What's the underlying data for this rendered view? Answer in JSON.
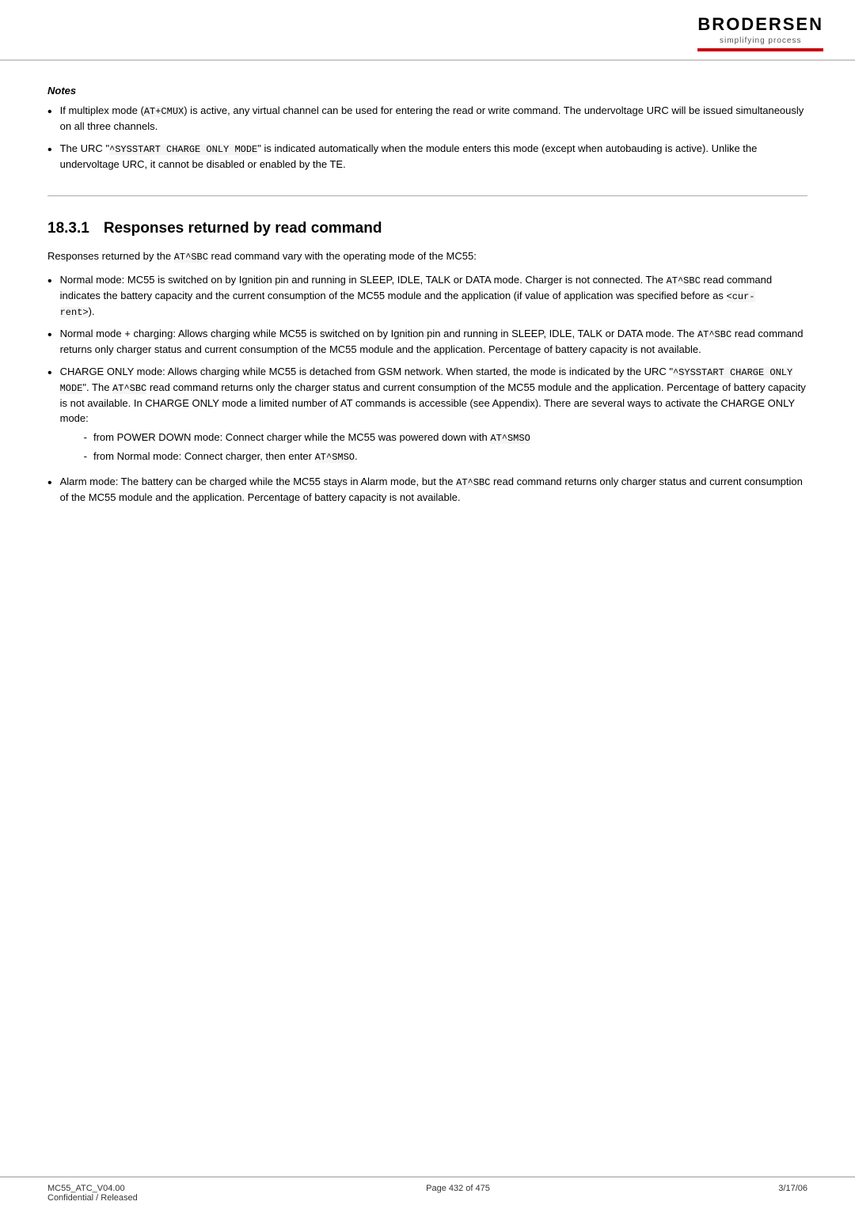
{
  "header": {
    "logo_text": "BRODERSEN",
    "logo_tagline": "simplifying process"
  },
  "notes": {
    "title": "Notes",
    "items": [
      {
        "text_before": "If multiplex mode (",
        "code1": "AT+CMUX",
        "text_after": ") is active, any virtual channel can be used for entering the read or write command. The undervoltage URC will be issued simultaneously on all three channels."
      },
      {
        "text_before": "The URC \"",
        "code1": "^SYSSTART CHARGE ONLY MODE",
        "text_after": "\" is indicated automatically when the module enters this mode (except when autobauding is active). Unlike the undervoltage URC, it cannot be disabled or enabled by the TE."
      }
    ]
  },
  "section": {
    "number": "18.3.1",
    "title": "Responses returned by read command",
    "intro_before": "Responses returned by the ",
    "intro_code": "AT^SBC",
    "intro_after": " read command vary with the operating mode of the MC55:",
    "bullets": [
      {
        "id": 0,
        "parts": [
          {
            "type": "text",
            "value": "Normal mode: MC55 is switched on by Ignition pin and running in SLEEP, IDLE, TALK or DATA mode. Charger is not connected. The "
          },
          {
            "type": "code",
            "value": "AT^SBC"
          },
          {
            "type": "text",
            "value": " read command indicates the battery capacity and the current consumption of the MC55 module and the application (if value of application was specified before as "
          },
          {
            "type": "code",
            "value": "<current>"
          },
          {
            "type": "text",
            "value": ")."
          }
        ]
      },
      {
        "id": 1,
        "parts": [
          {
            "type": "text",
            "value": "Normal mode + charging: Allows charging while MC55 is switched on by Ignition pin and running in SLEEP, IDLE, TALK or DATA mode. The "
          },
          {
            "type": "code",
            "value": "AT^SBC"
          },
          {
            "type": "text",
            "value": " read command returns only charger status and current consumption of the MC55 module and the application. Percentage of battery capacity is not available."
          }
        ]
      },
      {
        "id": 2,
        "parts": [
          {
            "type": "text",
            "value": "CHARGE ONLY mode: Allows charging while MC55 is detached from GSM network. When started, the mode is indicated by the URC \""
          },
          {
            "type": "code",
            "value": "^SYSSTART CHARGE ONLY MODE"
          },
          {
            "type": "text",
            "value": "\". The "
          },
          {
            "type": "code",
            "value": "AT^SBC"
          },
          {
            "type": "text",
            "value": " read command returns only the charger status and current consumption of the MC55 module and the application. Percentage of battery capacity is not available. In CHARGE ONLY mode a limited number of AT commands is accessible (see Appendix). There are several ways to activate the CHARGE ONLY mode:"
          }
        ],
        "sub_bullets": [
          {
            "parts": [
              {
                "type": "text",
                "value": "from POWER DOWN mode: Connect charger while the MC55 was powered down with "
              },
              {
                "type": "code",
                "value": "AT^SMSO"
              }
            ]
          },
          {
            "parts": [
              {
                "type": "text",
                "value": "from Normal mode: Connect charger, then enter "
              },
              {
                "type": "code",
                "value": "AT^SMSO"
              },
              {
                "type": "text",
                "value": "."
              }
            ]
          }
        ]
      },
      {
        "id": 3,
        "parts": [
          {
            "type": "text",
            "value": "Alarm mode: The battery can be charged while the MC55 stays in Alarm mode, but the "
          },
          {
            "type": "code",
            "value": "AT^SBC"
          },
          {
            "type": "text",
            "value": " read command returns only charger status and current consumption of the MC55 module and the application. Percentage of battery capacity is not available."
          }
        ]
      }
    ]
  },
  "footer": {
    "left_line1": "MC55_ATC_V04.00",
    "left_line2": "Confidential / Released",
    "center": "Page 432 of 475",
    "right": "3/17/06"
  }
}
